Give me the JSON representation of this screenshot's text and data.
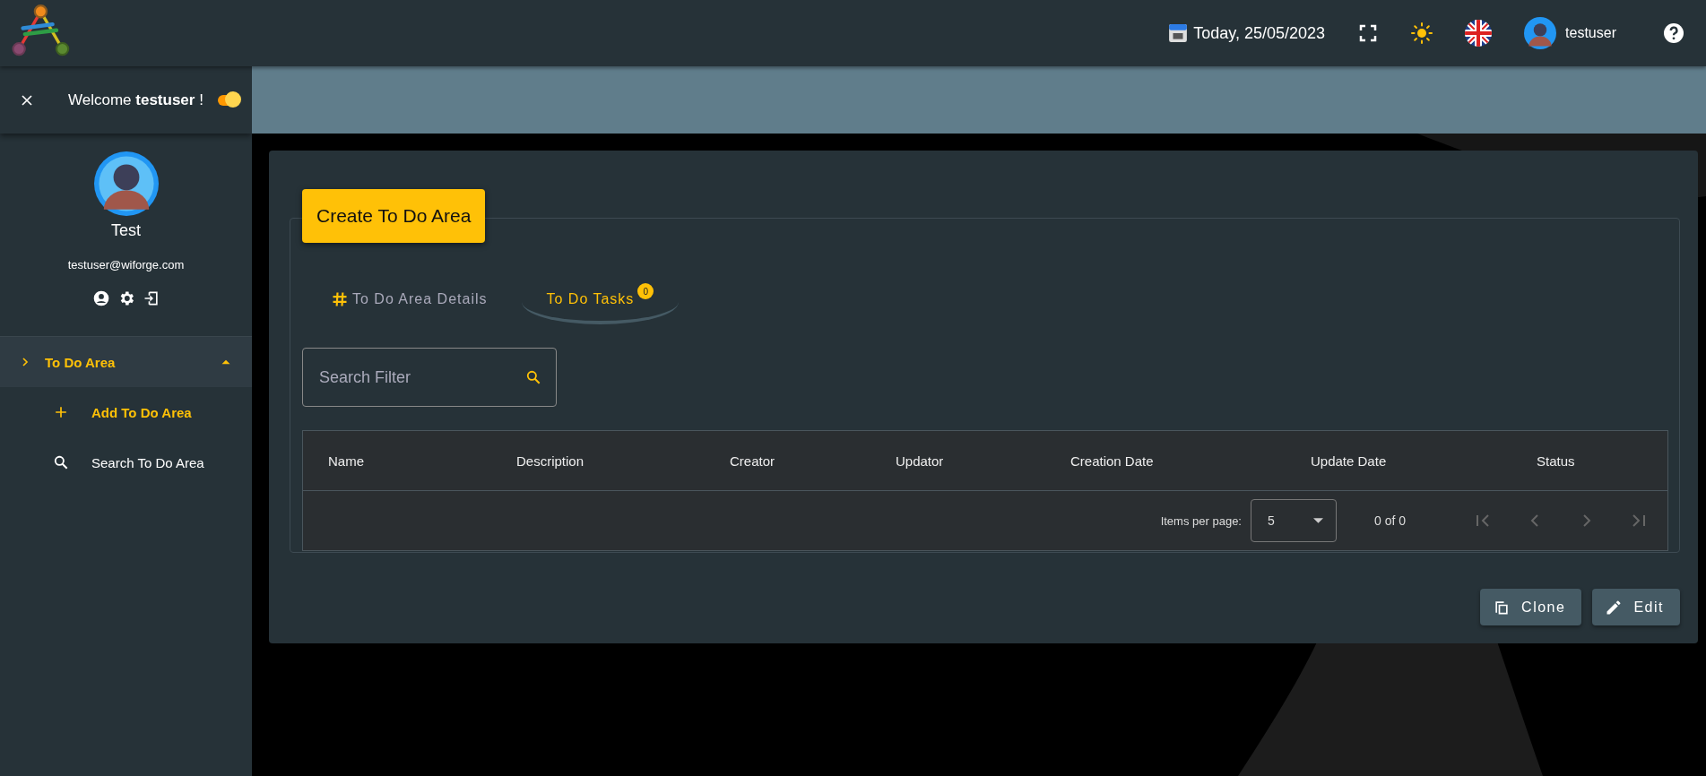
{
  "header": {
    "date": "Today, 25/05/2023",
    "username": "testuser"
  },
  "sidebar": {
    "welcome": {
      "prefix": "Welcome ",
      "name": "testuser",
      "suffix": " !"
    },
    "toggle": {
      "on": true
    },
    "profile": {
      "name": "Test",
      "email": "testuser@wiforge.com"
    },
    "items": [
      {
        "label": "To Do Area",
        "selected": true,
        "expanded": true,
        "children": [
          {
            "label": "Add To Do Area",
            "kind": "add",
            "selected": true
          },
          {
            "label": "Search To Do Area",
            "kind": "search",
            "selected": false
          }
        ]
      }
    ]
  },
  "card": {
    "title": "Create To Do Area",
    "tabs": [
      {
        "label": "To Do Area Details",
        "kind": "details",
        "selected": false
      },
      {
        "label": "To Do Tasks",
        "kind": "tasks",
        "selected": true,
        "badge": "0"
      }
    ],
    "search": {
      "placeholder": "Search Filter"
    },
    "table": {
      "columns": [
        "Name",
        "Description",
        "Creator",
        "Updator",
        "Creation Date",
        "Update Date",
        "Status"
      ]
    },
    "pagination": {
      "label": "Items per page:",
      "page_size": "5",
      "range": "0 of 0",
      "nav": [
        {
          "kind": "first",
          "disabled": true
        },
        {
          "kind": "prev",
          "disabled": true
        },
        {
          "kind": "next",
          "disabled": true
        },
        {
          "kind": "last",
          "disabled": true
        }
      ]
    },
    "buttons": [
      {
        "label": "Clone",
        "kind": "clone"
      },
      {
        "label": "Edit",
        "kind": "edit"
      }
    ]
  }
}
